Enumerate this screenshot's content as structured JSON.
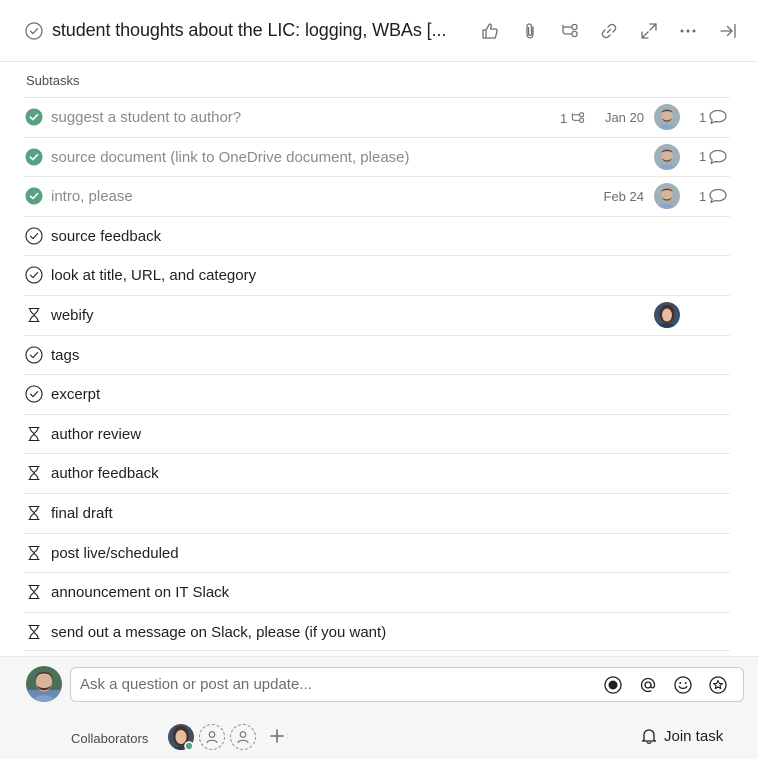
{
  "header": {
    "title": "student thoughts about the LIC: logging, WBAs [...",
    "icons": [
      "like-icon",
      "attachment-icon",
      "subtask-icon",
      "link-icon",
      "expand-icon",
      "more-icon",
      "close-panel-icon"
    ]
  },
  "subtasks": {
    "label": "Subtasks",
    "rows": [
      {
        "name": "suggest a student to author?",
        "status": "complete",
        "subtask_count": "1",
        "due": "Jan 20",
        "assignee": "male-avatar",
        "comments": "1"
      },
      {
        "name": "source document (link to OneDrive document, please)",
        "status": "complete",
        "subtask_count": "",
        "due": "",
        "assignee": "male-avatar",
        "comments": "1"
      },
      {
        "name": "intro, please",
        "status": "complete",
        "subtask_count": "",
        "due": "Feb 24",
        "assignee": "male-avatar",
        "comments": "1"
      },
      {
        "name": "source feedback",
        "status": "incomplete",
        "subtask_count": "",
        "due": "",
        "assignee": "",
        "comments": ""
      },
      {
        "name": "look at title, URL, and category",
        "status": "incomplete",
        "subtask_count": "",
        "due": "",
        "assignee": "",
        "comments": ""
      },
      {
        "name": "webify",
        "status": "waiting",
        "subtask_count": "",
        "due": "",
        "assignee": "female-avatar",
        "comments": ""
      },
      {
        "name": "tags",
        "status": "incomplete",
        "subtask_count": "",
        "due": "",
        "assignee": "",
        "comments": ""
      },
      {
        "name": "excerpt",
        "status": "incomplete",
        "subtask_count": "",
        "due": "",
        "assignee": "",
        "comments": ""
      },
      {
        "name": "author review",
        "status": "waiting",
        "subtask_count": "",
        "due": "",
        "assignee": "",
        "comments": ""
      },
      {
        "name": "author feedback",
        "status": "waiting",
        "subtask_count": "",
        "due": "",
        "assignee": "",
        "comments": ""
      },
      {
        "name": "final draft",
        "status": "waiting",
        "subtask_count": "",
        "due": "",
        "assignee": "",
        "comments": ""
      },
      {
        "name": "post live/scheduled",
        "status": "waiting",
        "subtask_count": "",
        "due": "",
        "assignee": "",
        "comments": ""
      },
      {
        "name": "announcement on IT Slack",
        "status": "waiting",
        "subtask_count": "",
        "due": "",
        "assignee": "",
        "comments": ""
      },
      {
        "name": "send out a message on Slack, please (if you want)",
        "status": "waiting",
        "subtask_count": "",
        "due": "",
        "assignee": "",
        "comments": ""
      }
    ]
  },
  "composer": {
    "placeholder": "Ask a question or post an update...",
    "icons": [
      "record-icon",
      "mention-icon",
      "emoji-icon",
      "star-icon"
    ]
  },
  "footer": {
    "collaborators_label": "Collaborators",
    "join_label": "Join task"
  },
  "colors": {
    "complete_green": "#58a182",
    "text": "#1e1f21",
    "muted": "#6d6e6f",
    "border": "#e8e8e8"
  }
}
